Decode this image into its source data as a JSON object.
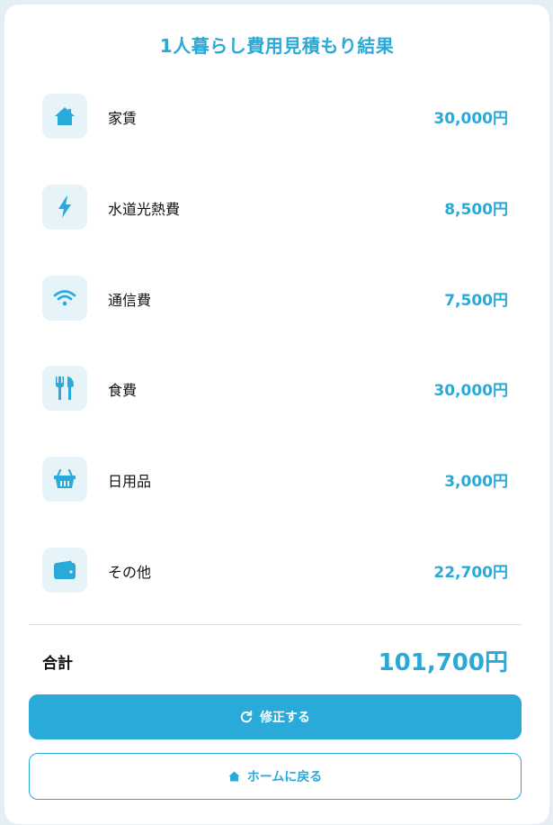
{
  "title": "1人暮らし費用見積もり結果",
  "items": [
    {
      "icon": "house-icon",
      "label": "家賃",
      "value": "30,000円"
    },
    {
      "icon": "lightning-icon",
      "label": "水道光熱費",
      "value": "8,500円"
    },
    {
      "icon": "wifi-icon",
      "label": "通信費",
      "value": "7,500円"
    },
    {
      "icon": "utensils-icon",
      "label": "食費",
      "value": "30,000円"
    },
    {
      "icon": "basket-icon",
      "label": "日用品",
      "value": "3,000円"
    },
    {
      "icon": "wallet-icon",
      "label": "その他",
      "value": "22,700円"
    }
  ],
  "total": {
    "label": "合計",
    "value": "101,700円"
  },
  "buttons": {
    "edit": "修正する",
    "home": "ホームに戻る"
  },
  "colors": {
    "accent": "#29aad8",
    "icon_bg": "#e6f4fa"
  }
}
